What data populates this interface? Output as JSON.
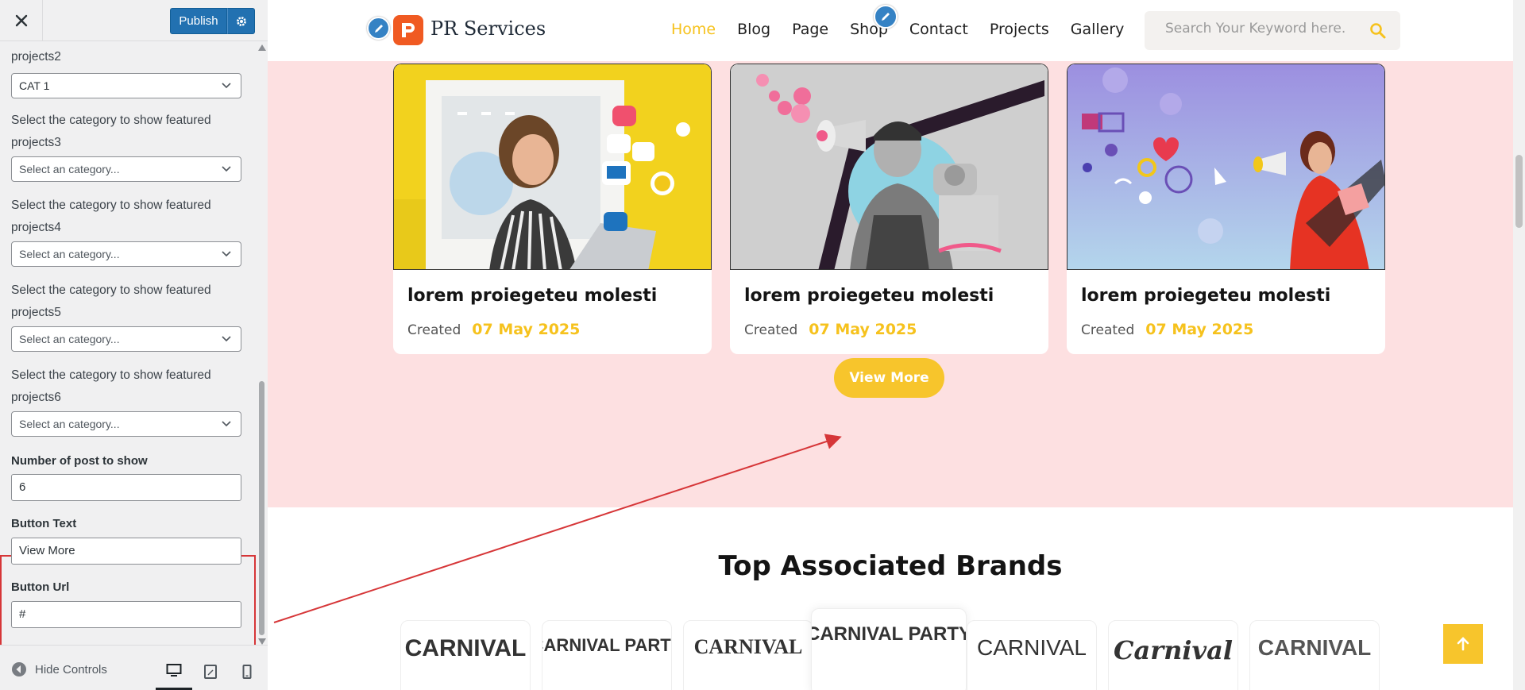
{
  "customizer": {
    "publish_label": "Publish",
    "fields": [
      {
        "label": "projects2",
        "type": "select",
        "value": "CAT 1"
      },
      {
        "label": "Select the category to show featured projects3",
        "type": "select",
        "value": "Select an category..."
      },
      {
        "label": "Select the category to show featured projects4",
        "type": "select",
        "value": "Select an category..."
      },
      {
        "label": "Select the category to show featured projects5",
        "type": "select",
        "value": "Select an category..."
      },
      {
        "label": "Select the category to show featured projects6",
        "type": "select",
        "value": "Select an category..."
      }
    ],
    "post_count": {
      "label": "Number of post to show",
      "value": "6"
    },
    "button_text": {
      "label": "Button Text",
      "value": "View More"
    },
    "button_url": {
      "label": "Button Url",
      "value": "#"
    },
    "hide_controls_label": "Hide Controls",
    "highlight_color": "#d63638",
    "accent_color": "#2271b1"
  },
  "site": {
    "logo_text": "PR Services",
    "nav": [
      "Home",
      "Blog",
      "Page",
      "Shop",
      "Contact",
      "Projects",
      "Gallery"
    ],
    "active_nav": "Home",
    "search_placeholder": "Search Your Keyword here.",
    "accent_color": "#f6c21d",
    "section_bg": "#fde0e1",
    "cards": [
      {
        "title": "lorem proiegeteu molesti",
        "meta_label": "Created",
        "date": "07 May 2025"
      },
      {
        "title": "lorem proiegeteu molesti",
        "meta_label": "Created",
        "date": "07 May 2025"
      },
      {
        "title": "lorem proiegeteu molesti",
        "meta_label": "Created",
        "date": "07 May 2025"
      }
    ],
    "slider_active_dot": 2,
    "view_more_label": "View More",
    "brands_title": "Top Associated Brands",
    "brands": [
      "CARNIVAL",
      "CARNIVAL PARTY",
      "CARNIVAL",
      "CARNIVAL PARTY",
      "CARNIVAL",
      "Carnival",
      "CARNIVAL"
    ]
  }
}
